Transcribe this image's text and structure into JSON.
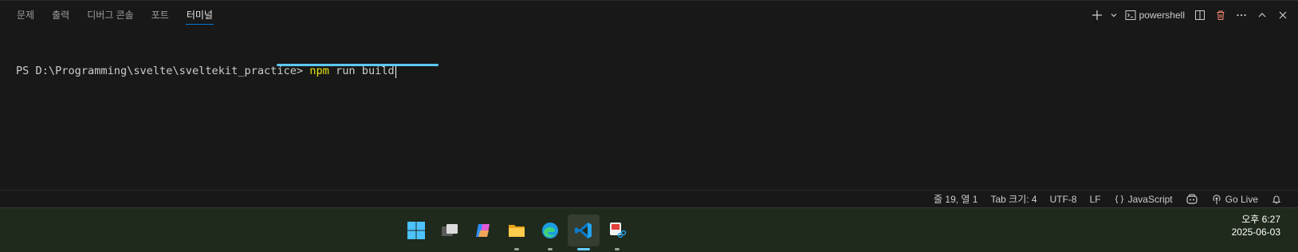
{
  "panel": {
    "tabs": [
      {
        "label": "문제",
        "active": false
      },
      {
        "label": "출력",
        "active": false
      },
      {
        "label": "디버그 콘솔",
        "active": false
      },
      {
        "label": "포트",
        "active": false
      },
      {
        "label": "터미널",
        "active": true
      }
    ],
    "profile_label": "powershell"
  },
  "terminal": {
    "prompt": "PS D:\\Programming\\svelte\\sveltekit_practice> ",
    "command": "npm",
    "args": " run build"
  },
  "statusbar": {
    "position": "줄 19, 열 1",
    "tab_size": "Tab 크기: 4",
    "encoding": "UTF-8",
    "eol": "LF",
    "language": "JavaScript",
    "golive": "Go Live"
  },
  "taskbar": {
    "apps": [
      "start-icon",
      "task-view-icon",
      "copilot-icon",
      "file-explorer-icon",
      "edge-icon",
      "vscode-icon",
      "snipping-tool-icon"
    ],
    "time": "오후 6:27",
    "date": "2025-06-03",
    "accent": "#60cdff"
  },
  "colors": {
    "panel_bg": "#181818",
    "active_tab_underline": "#0078d4",
    "command_yellow": "#e5e510",
    "underline_mark": "#5cc8f7",
    "taskbar_bg": "#202a1c"
  }
}
